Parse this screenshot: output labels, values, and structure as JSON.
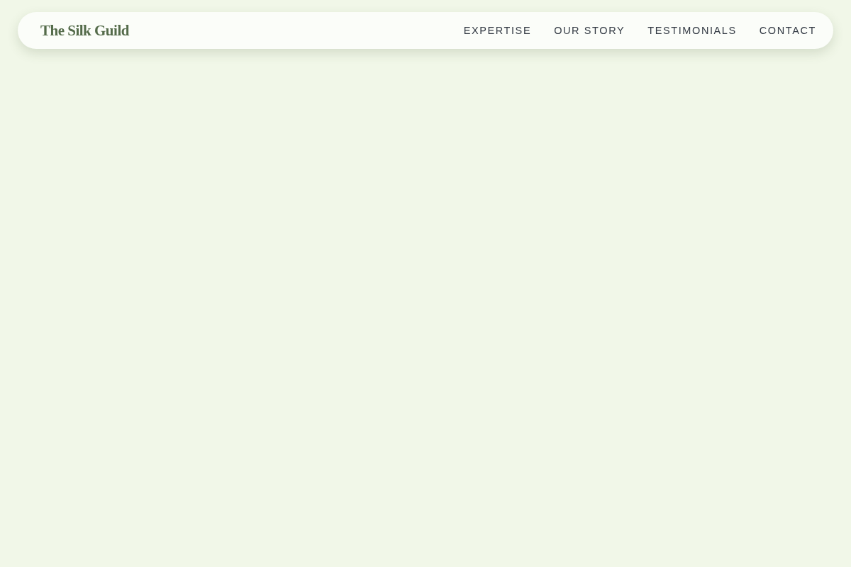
{
  "header": {
    "brand": "The Silk Guild",
    "nav": [
      {
        "label": "EXPERTISE"
      },
      {
        "label": "OUR STORY"
      },
      {
        "label": "TESTIMONIALS"
      },
      {
        "label": "CONTACT"
      }
    ]
  }
}
